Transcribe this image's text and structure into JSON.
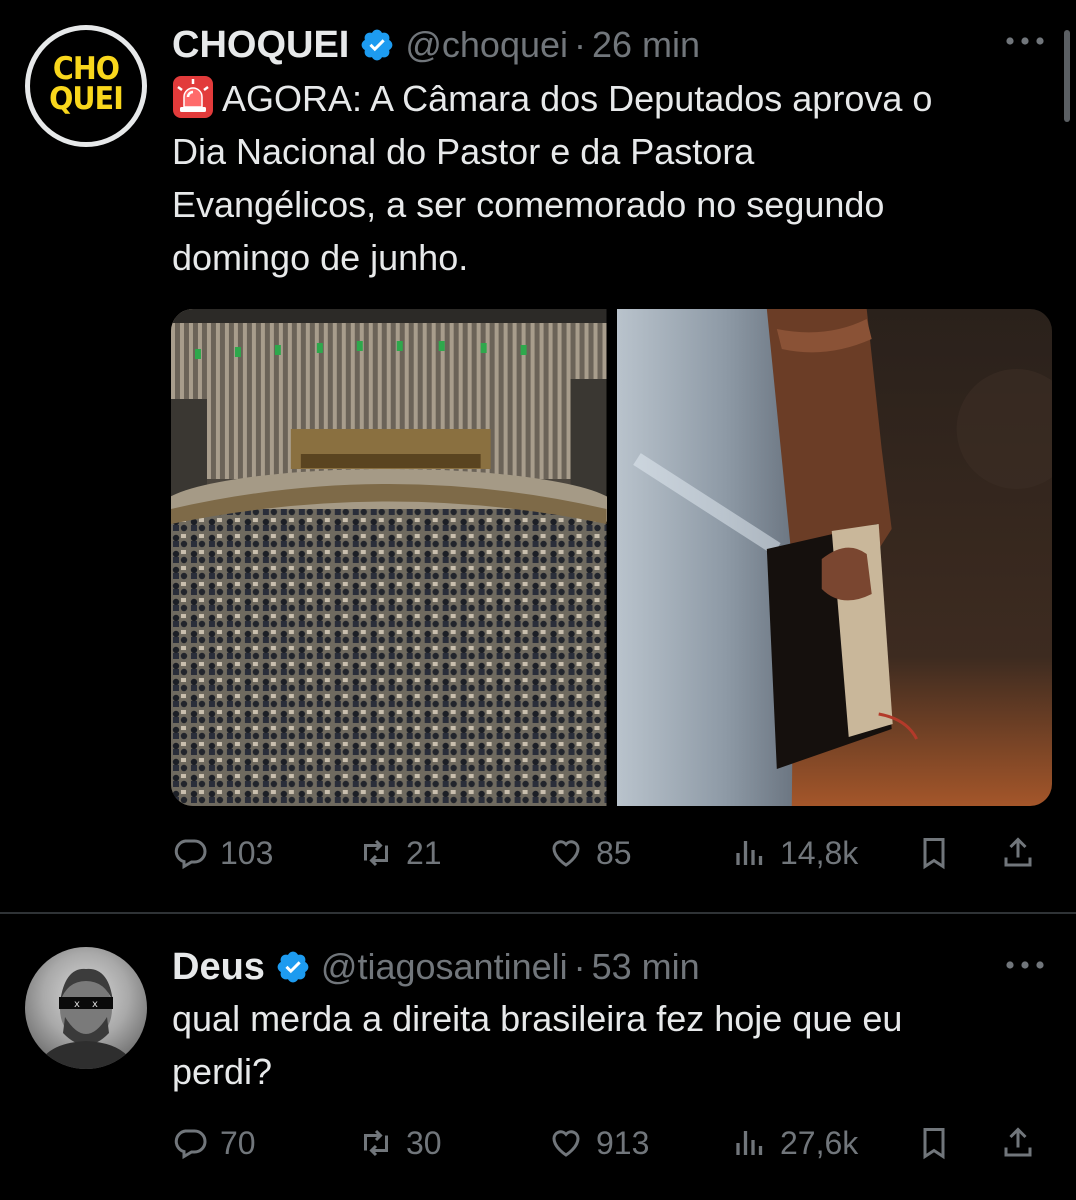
{
  "tweets": [
    {
      "avatar_logo": "CHO QUEI",
      "name": "CHOQUEI",
      "verified": true,
      "handle": "@choquei",
      "separator": "·",
      "time": "26 min",
      "emoji": "rotating-light-icon",
      "text_lines": [
        "AGORA: A Câmara dos Deputados aprova o",
        "Dia Nacional do Pastor e da Pastora",
        "Evangélicos, a ser comemorado no segundo",
        "domingo de junho."
      ],
      "media": [
        "chamber-of-deputies-photo",
        "hand-holding-bible-photo"
      ],
      "stats": {
        "replies": "103",
        "retweets": "21",
        "likes": "85",
        "views": "14,8k"
      }
    },
    {
      "name": "Deus",
      "verified": true,
      "handle": "@tiagosantineli",
      "separator": "·",
      "time": "53 min",
      "text_lines": [
        "qual merda a direita brasileira fez hoje que eu",
        "perdi?"
      ],
      "stats": {
        "replies": "70",
        "retweets": "30",
        "likes": "913",
        "views": "27,6k"
      }
    }
  ],
  "colors": {
    "background": "#000000",
    "text": "#e7e9ea",
    "muted": "#71767b",
    "verified": "#1d9bf0",
    "logo_yellow": "#f9d71c"
  }
}
